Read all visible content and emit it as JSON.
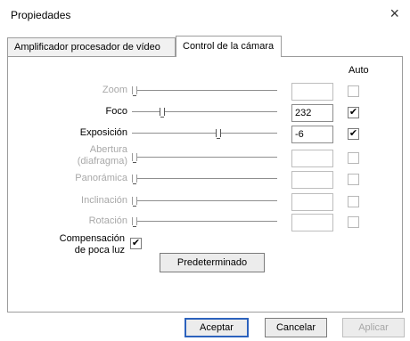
{
  "window": {
    "title": "Propiedades",
    "close_glyph": "×"
  },
  "tabs": [
    {
      "label": "Amplificador procesador de vídeo",
      "selected": false
    },
    {
      "label": "Control de la cámara",
      "selected": true
    }
  ],
  "panel": {
    "auto_header": "Auto",
    "controls": [
      {
        "label": "Zoom",
        "enabled": false,
        "value": "",
        "level": 0.0,
        "auto_checked": false
      },
      {
        "label": "Foco",
        "enabled": true,
        "value": "232",
        "level": 0.2,
        "auto_checked": true
      },
      {
        "label": "Exposición",
        "enabled": true,
        "value": "-6",
        "level": 0.6,
        "auto_checked": true
      },
      {
        "label_line1": "Abertura",
        "label_line2": "(diafragma)",
        "enabled": false,
        "value": "",
        "level": 0.0,
        "auto_checked": false
      },
      {
        "label": "Panorámica",
        "enabled": false,
        "value": "",
        "level": 0.0,
        "auto_checked": false
      },
      {
        "label": "Inclinación",
        "enabled": false,
        "value": "",
        "level": 0.0,
        "auto_checked": false
      },
      {
        "label": "Rotación",
        "enabled": false,
        "value": "",
        "level": 0.0,
        "auto_checked": false
      }
    ],
    "low_light": {
      "label_line1": "Compensación",
      "label_line2": "de poca luz",
      "checked": true,
      "check_glyph": "✔"
    },
    "default_button": "Predeterminado"
  },
  "footer": {
    "ok": "Aceptar",
    "cancel": "Cancelar",
    "apply": "Aplicar"
  },
  "check_glyph": "✔"
}
